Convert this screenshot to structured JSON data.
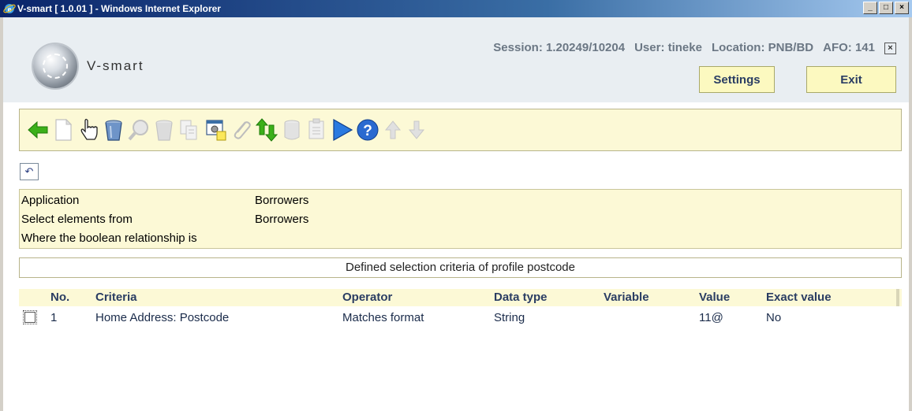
{
  "window": {
    "title": "V-smart [ 1.0.01 ] - Windows Internet Explorer",
    "minimize": "_",
    "maximize": "□",
    "close": "×"
  },
  "header": {
    "app_name": "V-smart",
    "session": "Session: 1.20249/10204",
    "user": "User: tineke",
    "location": "Location: PNB/BD",
    "afo": "AFO: 141",
    "close_symbol": "×",
    "settings_label": "Settings",
    "exit_label": "Exit"
  },
  "toolbar": {
    "icons": [
      "back-arrow-icon",
      "new-document-icon",
      "hand-pointer-icon",
      "delete-bin-icon",
      "search-disabled-icon",
      "bin-disabled-icon",
      "copy-disabled-icon",
      "properties-icon",
      "attach-disabled-icon",
      "sort-updown-icon",
      "database-disabled-icon",
      "clipboard-disabled-icon",
      "play-icon",
      "help-icon",
      "up-arrow-disabled-icon",
      "down-arrow-disabled-icon"
    ]
  },
  "undo_symbol": "↶",
  "info": {
    "application_label": "Application",
    "application_value": "Borrowers",
    "select_label": "Select elements from",
    "select_value": "Borrowers",
    "boolean_label": "Where the boolean relationship is",
    "boolean_value": ""
  },
  "criteria_title": "Defined selection criteria of profile postcode",
  "table": {
    "columns": [
      "No.",
      "Criteria",
      "Operator",
      "Data type",
      "Variable",
      "Value",
      "Exact value"
    ],
    "rows": [
      {
        "no": "1",
        "criteria": "Home Address: Postcode",
        "operator": "Matches format",
        "data_type": "String",
        "variable": "",
        "value": "11@",
        "exact": "No"
      }
    ]
  },
  "colors": {
    "panel_bg": "#fcf9d6",
    "button_bg": "#fcf9c0",
    "header_bg": "#e9eef2",
    "header_text": "#2a3d63"
  }
}
